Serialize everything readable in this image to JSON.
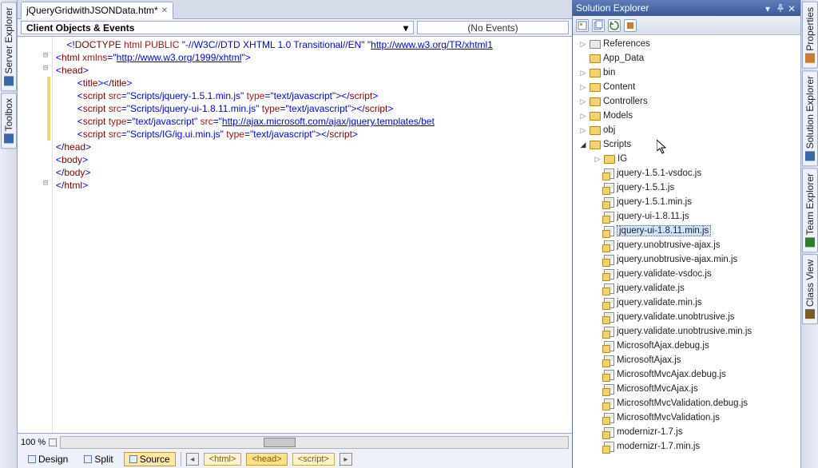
{
  "doc_tab": {
    "title": "jQueryGridwithJSONData.htm*"
  },
  "left_tabs": {
    "server_explorer": "Server Explorer",
    "toolbox": "Toolbox"
  },
  "right_tabs": {
    "properties": "Properties",
    "solution_explorer": "Solution Explorer",
    "team_explorer": "Team Explorer",
    "class_view": "Class View"
  },
  "combo": {
    "left": "Client Objects & Events",
    "right": "(No Events)"
  },
  "zoom": "100 %",
  "view_buttons": {
    "design": "Design",
    "split": "Split",
    "source": "Source"
  },
  "breadcrumbs": [
    "<html>",
    "<head>",
    "<script>"
  ],
  "code_lines": [
    {
      "indent": 1,
      "tokens": [
        {
          "t": "<!",
          "c": "c-blue"
        },
        {
          "t": "DOCTYPE",
          "c": "c-brown"
        },
        {
          "t": " ",
          "c": ""
        },
        {
          "t": "html",
          "c": "c-red"
        },
        {
          "t": " ",
          "c": ""
        },
        {
          "t": "PUBLIC",
          "c": "c-red"
        },
        {
          "t": " ",
          "c": ""
        },
        {
          "t": "\"-//W3C//DTD XHTML 1.0 Transitional//EN\"",
          "c": "c-blue"
        },
        {
          "t": " ",
          "c": ""
        },
        {
          "t": "\"",
          "c": "c-blue"
        },
        {
          "t": "http://www.w3.org/TR/xhtml1",
          "c": "c-link"
        }
      ]
    },
    {
      "indent": 0,
      "tokens": [
        {
          "t": "<",
          "c": "c-blue"
        },
        {
          "t": "html",
          "c": "c-brown"
        },
        {
          "t": " ",
          "c": ""
        },
        {
          "t": "xmlns",
          "c": "c-red"
        },
        {
          "t": "=",
          "c": "c-blue"
        },
        {
          "t": "\"",
          "c": "c-blue"
        },
        {
          "t": "http://www.w3.org/1999/xhtml",
          "c": "c-link"
        },
        {
          "t": "\"",
          "c": "c-blue"
        },
        {
          "t": ">",
          "c": "c-blue"
        }
      ]
    },
    {
      "indent": 0,
      "tokens": [
        {
          "t": "<",
          "c": "c-blue"
        },
        {
          "t": "head",
          "c": "c-brown"
        },
        {
          "t": ">",
          "c": "c-blue"
        }
      ]
    },
    {
      "indent": 2,
      "tokens": [
        {
          "t": "<",
          "c": "c-blue"
        },
        {
          "t": "title",
          "c": "c-brown"
        },
        {
          "t": "></",
          "c": "c-blue"
        },
        {
          "t": "title",
          "c": "c-brown"
        },
        {
          "t": ">",
          "c": "c-blue"
        }
      ]
    },
    {
      "indent": 2,
      "tokens": [
        {
          "t": "<",
          "c": "c-blue"
        },
        {
          "t": "script",
          "c": "c-brown"
        },
        {
          "t": " ",
          "c": ""
        },
        {
          "t": "src",
          "c": "c-red"
        },
        {
          "t": "=",
          "c": "c-blue"
        },
        {
          "t": "\"Scripts/jquery-1.5.1.min.js\"",
          "c": "c-blue"
        },
        {
          "t": " ",
          "c": ""
        },
        {
          "t": "type",
          "c": "c-red"
        },
        {
          "t": "=",
          "c": "c-blue"
        },
        {
          "t": "\"text/javascript\"",
          "c": "c-blue"
        },
        {
          "t": "></",
          "c": "c-blue"
        },
        {
          "t": "script",
          "c": "c-brown"
        },
        {
          "t": ">",
          "c": "c-blue"
        }
      ]
    },
    {
      "indent": 2,
      "tokens": [
        {
          "t": "<",
          "c": "c-blue"
        },
        {
          "t": "script",
          "c": "c-brown"
        },
        {
          "t": " ",
          "c": ""
        },
        {
          "t": "src",
          "c": "c-red"
        },
        {
          "t": "=",
          "c": "c-blue"
        },
        {
          "t": "\"Scripts/jquery-ui-1.8.11.min.js\"",
          "c": "c-blue"
        },
        {
          "t": " ",
          "c": ""
        },
        {
          "t": "type",
          "c": "c-red"
        },
        {
          "t": "=",
          "c": "c-blue"
        },
        {
          "t": "\"text/javascript\"",
          "c": "c-blue"
        },
        {
          "t": "></",
          "c": "c-blue"
        },
        {
          "t": "script",
          "c": "c-brown"
        },
        {
          "t": ">",
          "c": "c-blue"
        }
      ]
    },
    {
      "indent": 2,
      "tokens": [
        {
          "t": "<",
          "c": "c-blue"
        },
        {
          "t": "script",
          "c": "c-brown"
        },
        {
          "t": " ",
          "c": ""
        },
        {
          "t": "type",
          "c": "c-red"
        },
        {
          "t": "=",
          "c": "c-blue"
        },
        {
          "t": "\"text/javascript\"",
          "c": "c-blue"
        },
        {
          "t": " ",
          "c": ""
        },
        {
          "t": "src",
          "c": "c-red"
        },
        {
          "t": "=",
          "c": "c-blue"
        },
        {
          "t": "\"",
          "c": "c-blue"
        },
        {
          "t": "http://ajax.microsoft.com/ajax/jquery.templates/bet",
          "c": "c-link"
        }
      ]
    },
    {
      "indent": 2,
      "tokens": [
        {
          "t": "<",
          "c": "c-blue"
        },
        {
          "t": "script",
          "c": "c-brown"
        },
        {
          "t": " ",
          "c": ""
        },
        {
          "t": "src",
          "c": "c-red"
        },
        {
          "t": "=",
          "c": "c-blue"
        },
        {
          "t": "\"Scripts/IG/ig.ui.min.js\"",
          "c": "c-blue"
        },
        {
          "t": " ",
          "c": ""
        },
        {
          "t": "type",
          "c": "c-red"
        },
        {
          "t": "=",
          "c": "c-blue"
        },
        {
          "t": "\"text/javascript\"",
          "c": "c-blue"
        },
        {
          "t": "></",
          "c": "c-blue"
        },
        {
          "t": "script",
          "c": "c-brown"
        },
        {
          "t": ">",
          "c": "c-blue"
        }
      ]
    },
    {
      "indent": 0,
      "tokens": []
    },
    {
      "indent": 0,
      "tokens": []
    },
    {
      "indent": 0,
      "tokens": [
        {
          "t": "</",
          "c": "c-blue"
        },
        {
          "t": "head",
          "c": "c-brown"
        },
        {
          "t": ">",
          "c": "c-blue"
        }
      ]
    },
    {
      "indent": 0,
      "tokens": [
        {
          "t": "<",
          "c": "c-blue"
        },
        {
          "t": "body",
          "c": "c-brown"
        },
        {
          "t": ">",
          "c": "c-blue"
        }
      ]
    },
    {
      "indent": 0,
      "tokens": []
    },
    {
      "indent": 0,
      "tokens": [
        {
          "t": "</",
          "c": "c-blue"
        },
        {
          "t": "body",
          "c": "c-brown"
        },
        {
          "t": ">",
          "c": "c-blue"
        }
      ]
    },
    {
      "indent": 0,
      "tokens": [
        {
          "t": "</",
          "c": "c-blue"
        },
        {
          "t": "html",
          "c": "c-brown"
        },
        {
          "t": ">",
          "c": "c-blue"
        }
      ]
    }
  ],
  "outline_marks": [
    {
      "line": 1,
      "glyph": "⊟"
    },
    {
      "line": 2,
      "glyph": "⊟"
    },
    {
      "line": 11,
      "glyph": "⊟"
    }
  ],
  "yellow_bar": {
    "from": 3,
    "to": 7
  },
  "solution_explorer": {
    "title": "Solution Explorer",
    "nodes": [
      {
        "depth": 0,
        "arrow": "▷",
        "icon": "ref",
        "label": "References"
      },
      {
        "depth": 0,
        "arrow": "",
        "icon": "folder",
        "label": "App_Data"
      },
      {
        "depth": 0,
        "arrow": "▷",
        "icon": "folder",
        "label": "bin"
      },
      {
        "depth": 0,
        "arrow": "▷",
        "icon": "folder",
        "label": "Content"
      },
      {
        "depth": 0,
        "arrow": "▷",
        "icon": "folder",
        "label": "Controllers"
      },
      {
        "depth": 0,
        "arrow": "▷",
        "icon": "folder",
        "label": "Models"
      },
      {
        "depth": 0,
        "arrow": "▷",
        "icon": "folder",
        "label": "obj"
      },
      {
        "depth": 0,
        "arrow": "◢",
        "icon": "folder",
        "label": "Scripts"
      },
      {
        "depth": 1,
        "arrow": "▷",
        "icon": "folder",
        "label": "IG"
      },
      {
        "depth": 1,
        "arrow": "",
        "icon": "js",
        "label": "jquery-1.5.1-vsdoc.js"
      },
      {
        "depth": 1,
        "arrow": "",
        "icon": "js",
        "label": "jquery-1.5.1.js"
      },
      {
        "depth": 1,
        "arrow": "",
        "icon": "js",
        "label": "jquery-1.5.1.min.js"
      },
      {
        "depth": 1,
        "arrow": "",
        "icon": "js",
        "label": "jquery-ui-1.8.11.js"
      },
      {
        "depth": 1,
        "arrow": "",
        "icon": "js",
        "label": "jquery-ui-1.8.11.min.js",
        "selected": true
      },
      {
        "depth": 1,
        "arrow": "",
        "icon": "js",
        "label": "jquery.unobtrusive-ajax.js"
      },
      {
        "depth": 1,
        "arrow": "",
        "icon": "js",
        "label": "jquery.unobtrusive-ajax.min.js"
      },
      {
        "depth": 1,
        "arrow": "",
        "icon": "js",
        "label": "jquery.validate-vsdoc.js"
      },
      {
        "depth": 1,
        "arrow": "",
        "icon": "js",
        "label": "jquery.validate.js"
      },
      {
        "depth": 1,
        "arrow": "",
        "icon": "js",
        "label": "jquery.validate.min.js"
      },
      {
        "depth": 1,
        "arrow": "",
        "icon": "js",
        "label": "jquery.validate.unobtrusive.js"
      },
      {
        "depth": 1,
        "arrow": "",
        "icon": "js",
        "label": "jquery.validate.unobtrusive.min.js"
      },
      {
        "depth": 1,
        "arrow": "",
        "icon": "js",
        "label": "MicrosoftAjax.debug.js"
      },
      {
        "depth": 1,
        "arrow": "",
        "icon": "js",
        "label": "MicrosoftAjax.js"
      },
      {
        "depth": 1,
        "arrow": "",
        "icon": "js",
        "label": "MicrosoftMvcAjax.debug.js"
      },
      {
        "depth": 1,
        "arrow": "",
        "icon": "js",
        "label": "MicrosoftMvcAjax.js"
      },
      {
        "depth": 1,
        "arrow": "",
        "icon": "js",
        "label": "MicrosoftMvcValidation.debug.js"
      },
      {
        "depth": 1,
        "arrow": "",
        "icon": "js",
        "label": "MicrosoftMvcValidation.js"
      },
      {
        "depth": 1,
        "arrow": "",
        "icon": "js",
        "label": "modernizr-1.7.js"
      },
      {
        "depth": 1,
        "arrow": "",
        "icon": "js",
        "label": "modernizr-1.7.min.js"
      }
    ]
  }
}
